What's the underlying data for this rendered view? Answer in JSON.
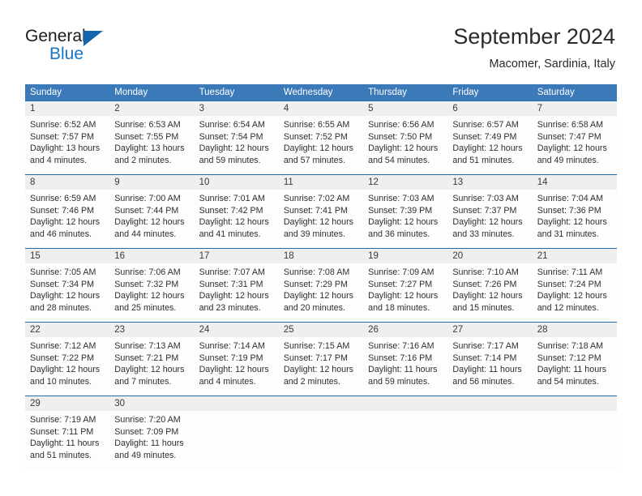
{
  "brand": {
    "name_dark": "General",
    "name_blue": "Blue",
    "accent_color": "#1676c6",
    "triangle_color": "#1565ad"
  },
  "header": {
    "title": "September 2024",
    "subtitle": "Macomer, Sardinia, Italy"
  },
  "calendar": {
    "header_bg": "#3b79b8",
    "row_border_color": "#1f6cb0",
    "daynum_band_color": "#efefef",
    "weekday_headers": [
      "Sunday",
      "Monday",
      "Tuesday",
      "Wednesday",
      "Thursday",
      "Friday",
      "Saturday"
    ],
    "weeks": [
      [
        {
          "day": "1",
          "sunrise": "Sunrise: 6:52 AM",
          "sunset": "Sunset: 7:57 PM",
          "daylight1": "Daylight: 13 hours",
          "daylight2": "and 4 minutes."
        },
        {
          "day": "2",
          "sunrise": "Sunrise: 6:53 AM",
          "sunset": "Sunset: 7:55 PM",
          "daylight1": "Daylight: 13 hours",
          "daylight2": "and 2 minutes."
        },
        {
          "day": "3",
          "sunrise": "Sunrise: 6:54 AM",
          "sunset": "Sunset: 7:54 PM",
          "daylight1": "Daylight: 12 hours",
          "daylight2": "and 59 minutes."
        },
        {
          "day": "4",
          "sunrise": "Sunrise: 6:55 AM",
          "sunset": "Sunset: 7:52 PM",
          "daylight1": "Daylight: 12 hours",
          "daylight2": "and 57 minutes."
        },
        {
          "day": "5",
          "sunrise": "Sunrise: 6:56 AM",
          "sunset": "Sunset: 7:50 PM",
          "daylight1": "Daylight: 12 hours",
          "daylight2": "and 54 minutes."
        },
        {
          "day": "6",
          "sunrise": "Sunrise: 6:57 AM",
          "sunset": "Sunset: 7:49 PM",
          "daylight1": "Daylight: 12 hours",
          "daylight2": "and 51 minutes."
        },
        {
          "day": "7",
          "sunrise": "Sunrise: 6:58 AM",
          "sunset": "Sunset: 7:47 PM",
          "daylight1": "Daylight: 12 hours",
          "daylight2": "and 49 minutes."
        }
      ],
      [
        {
          "day": "8",
          "sunrise": "Sunrise: 6:59 AM",
          "sunset": "Sunset: 7:46 PM",
          "daylight1": "Daylight: 12 hours",
          "daylight2": "and 46 minutes."
        },
        {
          "day": "9",
          "sunrise": "Sunrise: 7:00 AM",
          "sunset": "Sunset: 7:44 PM",
          "daylight1": "Daylight: 12 hours",
          "daylight2": "and 44 minutes."
        },
        {
          "day": "10",
          "sunrise": "Sunrise: 7:01 AM",
          "sunset": "Sunset: 7:42 PM",
          "daylight1": "Daylight: 12 hours",
          "daylight2": "and 41 minutes."
        },
        {
          "day": "11",
          "sunrise": "Sunrise: 7:02 AM",
          "sunset": "Sunset: 7:41 PM",
          "daylight1": "Daylight: 12 hours",
          "daylight2": "and 39 minutes."
        },
        {
          "day": "12",
          "sunrise": "Sunrise: 7:03 AM",
          "sunset": "Sunset: 7:39 PM",
          "daylight1": "Daylight: 12 hours",
          "daylight2": "and 36 minutes."
        },
        {
          "day": "13",
          "sunrise": "Sunrise: 7:03 AM",
          "sunset": "Sunset: 7:37 PM",
          "daylight1": "Daylight: 12 hours",
          "daylight2": "and 33 minutes."
        },
        {
          "day": "14",
          "sunrise": "Sunrise: 7:04 AM",
          "sunset": "Sunset: 7:36 PM",
          "daylight1": "Daylight: 12 hours",
          "daylight2": "and 31 minutes."
        }
      ],
      [
        {
          "day": "15",
          "sunrise": "Sunrise: 7:05 AM",
          "sunset": "Sunset: 7:34 PM",
          "daylight1": "Daylight: 12 hours",
          "daylight2": "and 28 minutes."
        },
        {
          "day": "16",
          "sunrise": "Sunrise: 7:06 AM",
          "sunset": "Sunset: 7:32 PM",
          "daylight1": "Daylight: 12 hours",
          "daylight2": "and 25 minutes."
        },
        {
          "day": "17",
          "sunrise": "Sunrise: 7:07 AM",
          "sunset": "Sunset: 7:31 PM",
          "daylight1": "Daylight: 12 hours",
          "daylight2": "and 23 minutes."
        },
        {
          "day": "18",
          "sunrise": "Sunrise: 7:08 AM",
          "sunset": "Sunset: 7:29 PM",
          "daylight1": "Daylight: 12 hours",
          "daylight2": "and 20 minutes."
        },
        {
          "day": "19",
          "sunrise": "Sunrise: 7:09 AM",
          "sunset": "Sunset: 7:27 PM",
          "daylight1": "Daylight: 12 hours",
          "daylight2": "and 18 minutes."
        },
        {
          "day": "20",
          "sunrise": "Sunrise: 7:10 AM",
          "sunset": "Sunset: 7:26 PM",
          "daylight1": "Daylight: 12 hours",
          "daylight2": "and 15 minutes."
        },
        {
          "day": "21",
          "sunrise": "Sunrise: 7:11 AM",
          "sunset": "Sunset: 7:24 PM",
          "daylight1": "Daylight: 12 hours",
          "daylight2": "and 12 minutes."
        }
      ],
      [
        {
          "day": "22",
          "sunrise": "Sunrise: 7:12 AM",
          "sunset": "Sunset: 7:22 PM",
          "daylight1": "Daylight: 12 hours",
          "daylight2": "and 10 minutes."
        },
        {
          "day": "23",
          "sunrise": "Sunrise: 7:13 AM",
          "sunset": "Sunset: 7:21 PM",
          "daylight1": "Daylight: 12 hours",
          "daylight2": "and 7 minutes."
        },
        {
          "day": "24",
          "sunrise": "Sunrise: 7:14 AM",
          "sunset": "Sunset: 7:19 PM",
          "daylight1": "Daylight: 12 hours",
          "daylight2": "and 4 minutes."
        },
        {
          "day": "25",
          "sunrise": "Sunrise: 7:15 AM",
          "sunset": "Sunset: 7:17 PM",
          "daylight1": "Daylight: 12 hours",
          "daylight2": "and 2 minutes."
        },
        {
          "day": "26",
          "sunrise": "Sunrise: 7:16 AM",
          "sunset": "Sunset: 7:16 PM",
          "daylight1": "Daylight: 11 hours",
          "daylight2": "and 59 minutes."
        },
        {
          "day": "27",
          "sunrise": "Sunrise: 7:17 AM",
          "sunset": "Sunset: 7:14 PM",
          "daylight1": "Daylight: 11 hours",
          "daylight2": "and 56 minutes."
        },
        {
          "day": "28",
          "sunrise": "Sunrise: 7:18 AM",
          "sunset": "Sunset: 7:12 PM",
          "daylight1": "Daylight: 11 hours",
          "daylight2": "and 54 minutes."
        }
      ],
      [
        {
          "day": "29",
          "sunrise": "Sunrise: 7:19 AM",
          "sunset": "Sunset: 7:11 PM",
          "daylight1": "Daylight: 11 hours",
          "daylight2": "and 51 minutes."
        },
        {
          "day": "30",
          "sunrise": "Sunrise: 7:20 AM",
          "sunset": "Sunset: 7:09 PM",
          "daylight1": "Daylight: 11 hours",
          "daylight2": "and 49 minutes."
        },
        {
          "day": "",
          "sunrise": "",
          "sunset": "",
          "daylight1": "",
          "daylight2": ""
        },
        {
          "day": "",
          "sunrise": "",
          "sunset": "",
          "daylight1": "",
          "daylight2": ""
        },
        {
          "day": "",
          "sunrise": "",
          "sunset": "",
          "daylight1": "",
          "daylight2": ""
        },
        {
          "day": "",
          "sunrise": "",
          "sunset": "",
          "daylight1": "",
          "daylight2": ""
        },
        {
          "day": "",
          "sunrise": "",
          "sunset": "",
          "daylight1": "",
          "daylight2": ""
        }
      ]
    ]
  }
}
